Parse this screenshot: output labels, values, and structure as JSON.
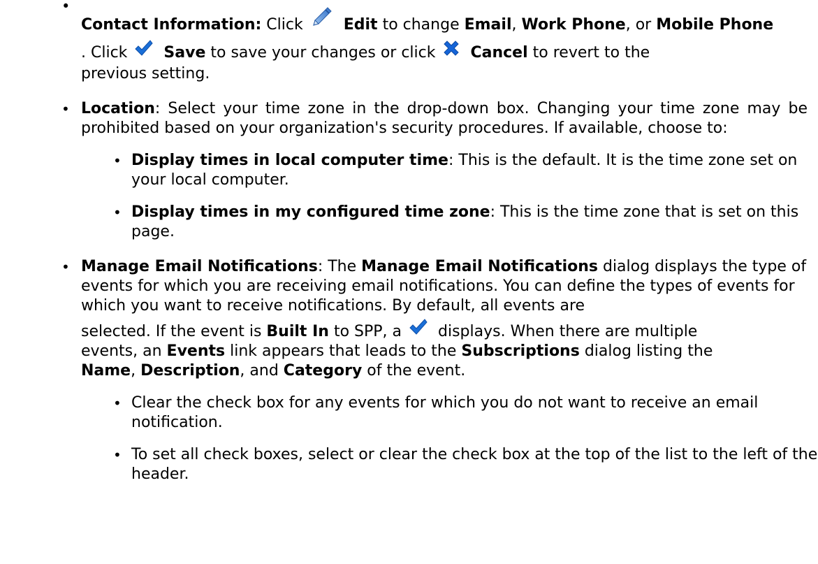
{
  "bullets": {
    "contact": {
      "label": "Contact Information:",
      "click1": "Click",
      "edit": "Edit",
      "to_change": "to change",
      "email": "Email",
      "comma1": ",",
      "work_phone": "Work Phone",
      "comma_or": ", or",
      "mobile_phone": "Mobile Phone",
      "dot_click": ". Click",
      "save": "Save",
      "save_rest": "to save your changes or click",
      "cancel": "Cancel",
      "cancel_rest": "to revert to the",
      "line3": "previous setting."
    },
    "location": {
      "label": "Location",
      "text": ": Select your time zone in the drop-down box. Changing your time zone may be prohibited based on your organization's security procedures. If available, choose to:",
      "sub1_label": "Display times in local computer time",
      "sub1_text": ": This is the default. It is the time zone set on your local computer.",
      "sub2_label": "Display times in my configured time zone",
      "sub2_text": ": This is the time zone that is set on this page."
    },
    "notifications": {
      "label": "Manage Email Notifications",
      "t1": ": The",
      "label2": "Manage Email Notifications",
      "t2": "dialog displays the type of events for which you are receiving email notifications. You can define the types of events for which you want to receive notifications. By default, all events are",
      "t3": "selected. If the event is",
      "built_in": "Built In",
      "t4": "to SPP, a",
      "t5": "displays. When there are multiple",
      "t6": "events, an",
      "events": "Events",
      "t7": "link appears that leads to the",
      "subscriptions": "Subscriptions",
      "t8": "dialog listing the",
      "name": "Name",
      "comma": ",",
      "description": "Description",
      "and": ", and",
      "category": "Category",
      "t9": "of the event.",
      "sub1": "Clear the check box for any events for which you do not want to receive an email notification.",
      "sub2": "To set all check boxes, select or clear the check box at the top of the list to the left of the header."
    }
  },
  "icons": {
    "edit": "pencil-icon",
    "save": "checkmark-icon",
    "cancel": "x-icon",
    "built_in": "checkmark-icon"
  },
  "colors": {
    "text": "#000000",
    "check": "#1a6fd8",
    "cancel_x": "#1565d8",
    "pencil": "#3a86d9"
  }
}
